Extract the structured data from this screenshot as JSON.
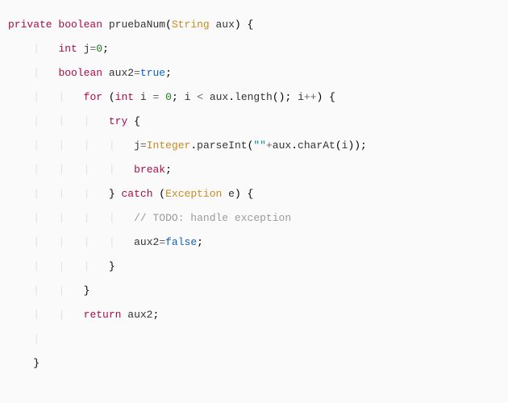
{
  "code": {
    "kw_private": "private",
    "kw_boolean": "boolean",
    "kw_int": "int",
    "kw_for": "for",
    "kw_try": "try",
    "kw_break": "break",
    "kw_catch": "catch",
    "kw_return": "return",
    "type_string": "String",
    "type_integer": "Integer",
    "type_exception": "Exception",
    "bool_true": "true",
    "bool_false": "false",
    "num_zero_a": "0",
    "num_zero_b": "0",
    "str_empty": "\"\"",
    "comment_todo": "// TODO: handle exception",
    "id_method": "pruebaNum",
    "id_aux": "aux",
    "id_j": "j",
    "id_aux2": "aux2",
    "id_i": "i",
    "id_e": "e",
    "call_length": "length",
    "call_parseInt": "parseInt",
    "call_charAt": "charAt"
  }
}
